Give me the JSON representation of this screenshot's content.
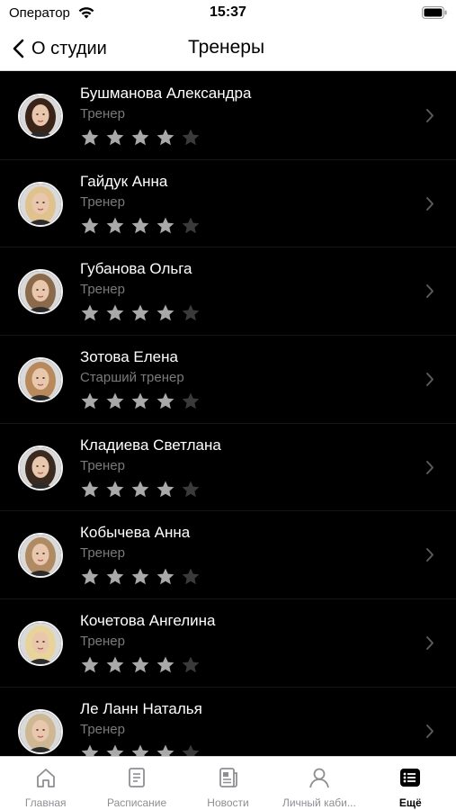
{
  "status_bar": {
    "carrier": "Оператор",
    "time": "15:37"
  },
  "nav": {
    "back_label": "О студии",
    "title": "Тренеры"
  },
  "trainers": [
    {
      "name": "Бушманова Александра",
      "role": "Тренер",
      "rating": 4,
      "max_rating": 5,
      "hair": "#3a2418"
    },
    {
      "name": "Гайдук Анна",
      "role": "Тренер",
      "rating": 4,
      "max_rating": 5,
      "hair": "#e0c28f"
    },
    {
      "name": "Губанова Ольга",
      "role": "Тренер",
      "rating": 4,
      "max_rating": 5,
      "hair": "#8a6a4a"
    },
    {
      "name": "Зотова Елена",
      "role": "Старший тренер",
      "rating": 4,
      "max_rating": 5,
      "hair": "#b8895a"
    },
    {
      "name": "Кладиева Светлана",
      "role": "Тренер",
      "rating": 4,
      "max_rating": 5,
      "hair": "#3b2a20"
    },
    {
      "name": "Кобычева Анна",
      "role": "Тренер",
      "rating": 4,
      "max_rating": 5,
      "hair": "#b08a62"
    },
    {
      "name": "Кочетова Ангелина",
      "role": "Тренер",
      "rating": 4,
      "max_rating": 5,
      "hair": "#e8d49a"
    },
    {
      "name": "Ле Ланн Наталья",
      "role": "Тренер",
      "rating": 4,
      "max_rating": 5,
      "hair": "#cdb893"
    }
  ],
  "tabs": [
    {
      "label": "Главная",
      "icon": "home-icon",
      "active": false
    },
    {
      "label": "Расписание",
      "icon": "schedule-icon",
      "active": false
    },
    {
      "label": "Новости",
      "icon": "news-icon",
      "active": false
    },
    {
      "label": "Личный каби...",
      "icon": "profile-icon",
      "active": false
    },
    {
      "label": "Ещё",
      "icon": "more-icon",
      "active": true
    }
  ],
  "colors": {
    "star_filled": "#a9a9a9",
    "star_empty": "#3a3a3a",
    "tab_inactive": "#8e8e93",
    "tab_active": "#000000"
  }
}
